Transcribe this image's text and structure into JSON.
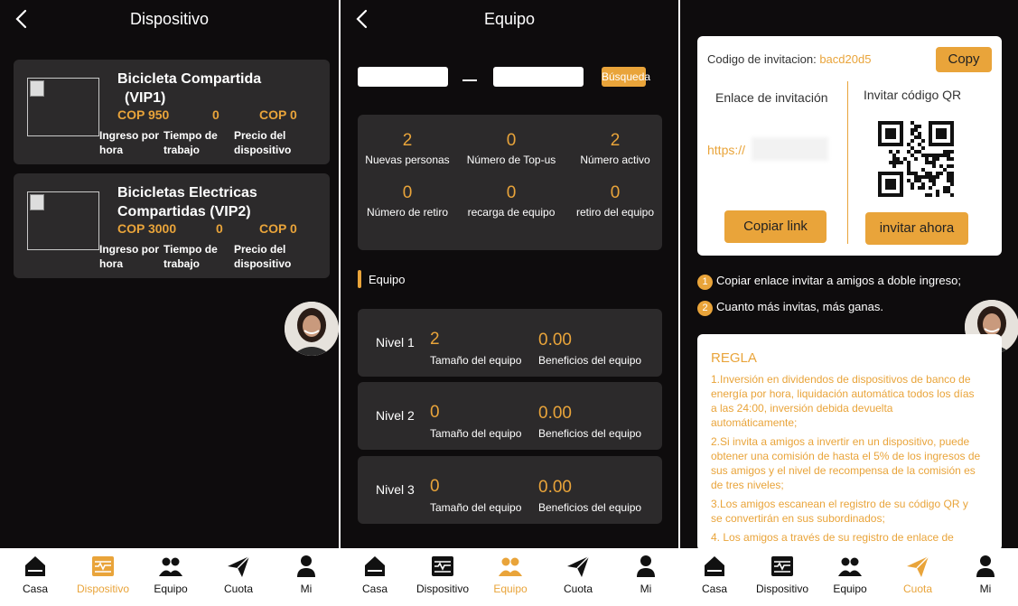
{
  "device_screen": {
    "title": "Dispositivo",
    "devices": [
      {
        "name_line1": "Bicicleta Compartida",
        "name_line2": "(VIP1)",
        "price": "COP 950",
        "hours": "0",
        "device_price": "COP 0",
        "label_income": "Ingreso por hora",
        "label_time": "Tiempo de trabajo",
        "label_price": "Precio del dispositivo"
      },
      {
        "name_line1": "Bicicletas Electricas",
        "name_line2": "Compartidas  (VIP2)",
        "price": "COP 3000",
        "hours": "0",
        "device_price": "COP 0",
        "label_income": "Ingreso por hora",
        "label_time": "Tiempo de trabajo",
        "label_price": "Precio del dispositivo"
      }
    ]
  },
  "team_screen": {
    "title": "Equipo",
    "search_label": "Búsqueda",
    "stats": [
      {
        "value": "2",
        "label": "Nuevas personas"
      },
      {
        "value": "0",
        "label": "Número de Top-us"
      },
      {
        "value": "2",
        "label": "Número activo"
      },
      {
        "value": "0",
        "label": "Número de retiro"
      },
      {
        "value": "0",
        "label": "recarga de equipo"
      },
      {
        "value": "0",
        "label": "retiro del equipo"
      }
    ],
    "section_title": "Equipo",
    "levels": [
      {
        "name": "Nivel 1",
        "size": "2",
        "benefit": "0.00"
      },
      {
        "name": "Nivel 2",
        "size": "0",
        "benefit": "0.00"
      },
      {
        "name": "Nivel 3",
        "size": "0",
        "benefit": "0.00"
      }
    ],
    "size_label": "Tamaño del equipo",
    "benefit_label": "Beneficios del equipo"
  },
  "invite_screen": {
    "code_label": "Codigo de invitacion:",
    "code_value": "bacd20d5",
    "copy_label": "Copy",
    "link_title": "Enlace de invitación",
    "qr_title": "Invitar código QR",
    "url_text": "https://",
    "copy_link_label": "Copiar link",
    "invite_now_label": "invitar ahora",
    "tips": [
      {
        "num": "1",
        "text": "Copiar enlace invitar a amigos a doble ingreso;"
      },
      {
        "num": "2",
        "text": "Cuanto más invitas, más ganas."
      }
    ],
    "rules_title": "REGLA",
    "rules": [
      "1.Inversión en dividendos de dispositivos de banco de energía por hora, liquidación automática todos los días a las 24:00, inversión debida devuelta automáticamente;",
      "2.Si invita a amigos a invertir en un dispositivo, puede obtener una comisión de hasta el 5% de los ingresos de sus amigos y el nivel de recompensa de la comisión es de tres niveles;",
      "3.Los amigos escanean el registro de su código QR y se convertirán en sus subordinados;",
      "4. Los amigos a través de su registro de enlace de"
    ]
  },
  "tabbar": {
    "items": [
      {
        "label": "Casa",
        "icon": "home-icon"
      },
      {
        "label": "Dispositivo",
        "icon": "device-icon"
      },
      {
        "label": "Equipo",
        "icon": "team-icon"
      },
      {
        "label": "Cuota",
        "icon": "send-icon"
      },
      {
        "label": "Mi",
        "icon": "user-icon"
      }
    ]
  },
  "colors": {
    "accent": "#e9a43a",
    "background": "#0e0c0d",
    "card": "#2c2a2b"
  }
}
